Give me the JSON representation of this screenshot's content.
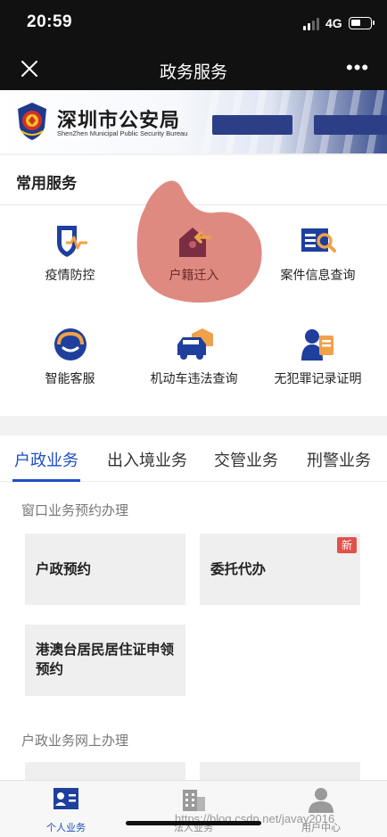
{
  "status_bar": {
    "time": "20:59",
    "network": "4G",
    "battery_level": 0.55
  },
  "nav": {
    "title": "政务服务"
  },
  "banner": {
    "name": "深圳市公安局",
    "english_name": "ShenZhen Municipal Public Security Bureau"
  },
  "common_services": {
    "title": "常用服务",
    "items": [
      {
        "label": "疫情防控",
        "icon": "shield-heartbeat-icon"
      },
      {
        "label": "户籍迁入",
        "icon": "house-arrow-icon"
      },
      {
        "label": "案件信息查询",
        "icon": "case-search-icon"
      },
      {
        "label": "智能客服",
        "icon": "headset-icon"
      },
      {
        "label": "机动车违法查询",
        "icon": "car-house-icon"
      },
      {
        "label": "无犯罪记录证明",
        "icon": "person-document-icon"
      }
    ]
  },
  "tabs": [
    {
      "label": "户政业务",
      "active": true
    },
    {
      "label": "出入境业务",
      "active": false
    },
    {
      "label": "交管业务",
      "active": false
    },
    {
      "label": "刑警业务",
      "active": false
    }
  ],
  "window_booking": {
    "title": "窗口业务预约办理",
    "tiles": [
      {
        "label": "户政预约"
      },
      {
        "label": "委托代办",
        "badge": "新"
      },
      {
        "label": "港澳台居民居住证申领预约"
      }
    ]
  },
  "online": {
    "title": "户政业务网上办理"
  },
  "bottom_nav": [
    {
      "label": "个人业务",
      "icon": "person-card-icon",
      "active": true
    },
    {
      "label": "法人业务",
      "icon": "building-icon",
      "active": false
    },
    {
      "label": "用户中心",
      "icon": "user-icon",
      "active": false
    }
  ],
  "watermark": "https://blog.csdn.net/javay2016",
  "colors": {
    "accent": "#1d4fc4",
    "badge": "#e4504a",
    "icon_blue": "#1e3f9c",
    "icon_orange": "#f0a24a",
    "highlight_blob": "#d9766b"
  }
}
